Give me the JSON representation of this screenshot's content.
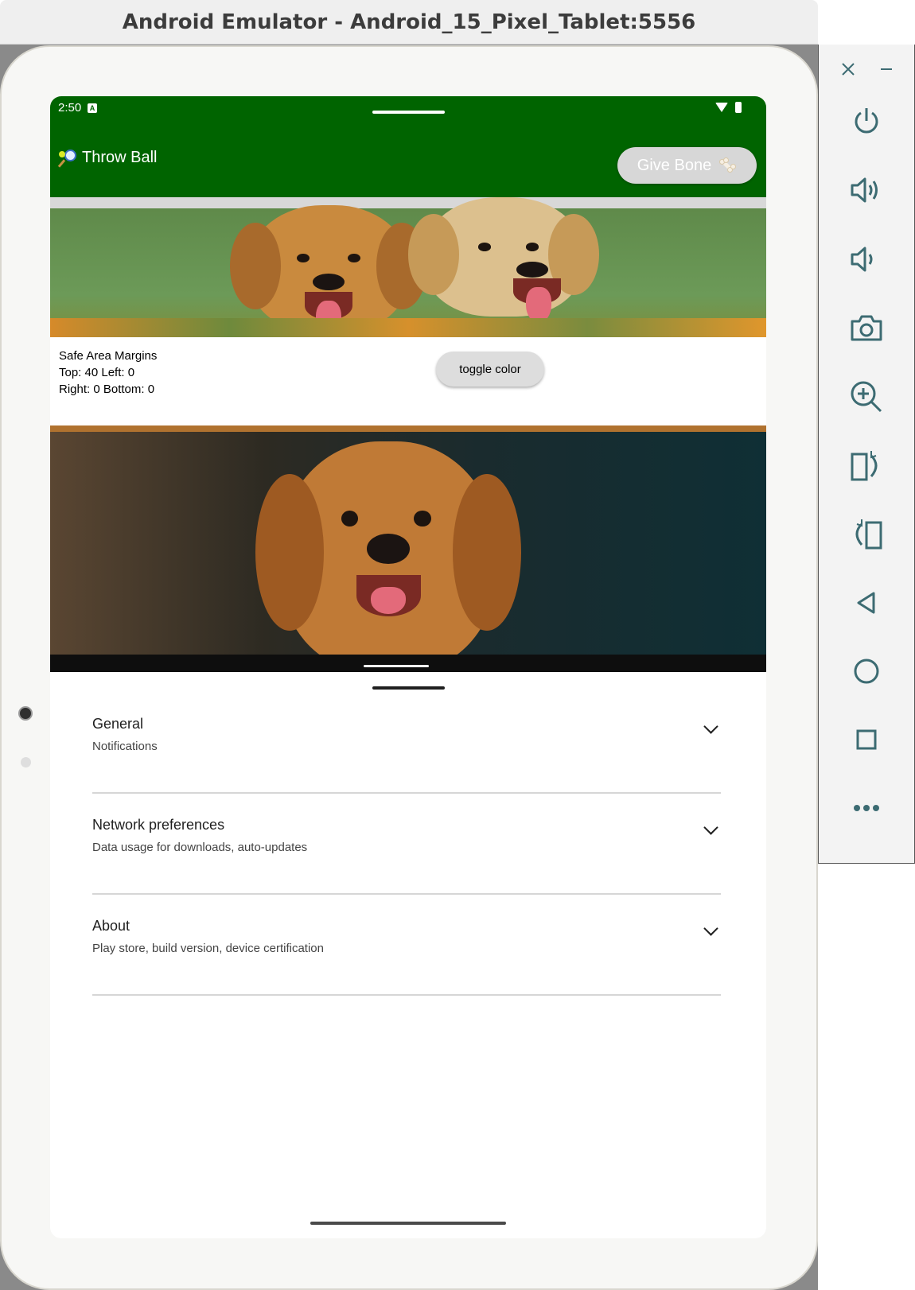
{
  "window": {
    "title": "Android Emulator - Android_15_Pixel_Tablet:5556"
  },
  "status_bar": {
    "time": "2:50",
    "notification_glyph": "A"
  },
  "app_bar": {
    "title": "Throw Ball",
    "title_icon": "tennis-racket-ball-icon",
    "action_button": "Give Bone",
    "action_icon": "bone-icon",
    "background_color": "#006400"
  },
  "safe_area": {
    "heading": "Safe Area Margins",
    "line1": "Top: 40 Left: 0",
    "line2": "Right: 0 Bottom: 0",
    "toggle_button": "toggle color"
  },
  "settings": {
    "items": [
      {
        "title": "General",
        "subtitle": "Notifications"
      },
      {
        "title": "Network preferences",
        "subtitle": "Data usage for downloads, auto-updates"
      },
      {
        "title": "About",
        "subtitle": "Play store, build version, device certification"
      }
    ]
  },
  "side_panel": {
    "icons": [
      "close-icon",
      "minimize-icon",
      "power-icon",
      "volume-up-icon",
      "volume-down-icon",
      "camera-icon",
      "zoom-in-icon",
      "rotate-left-icon",
      "rotate-right-icon",
      "back-icon",
      "home-icon",
      "overview-icon",
      "more-icon"
    ],
    "icon_color": "#3c6b72"
  }
}
